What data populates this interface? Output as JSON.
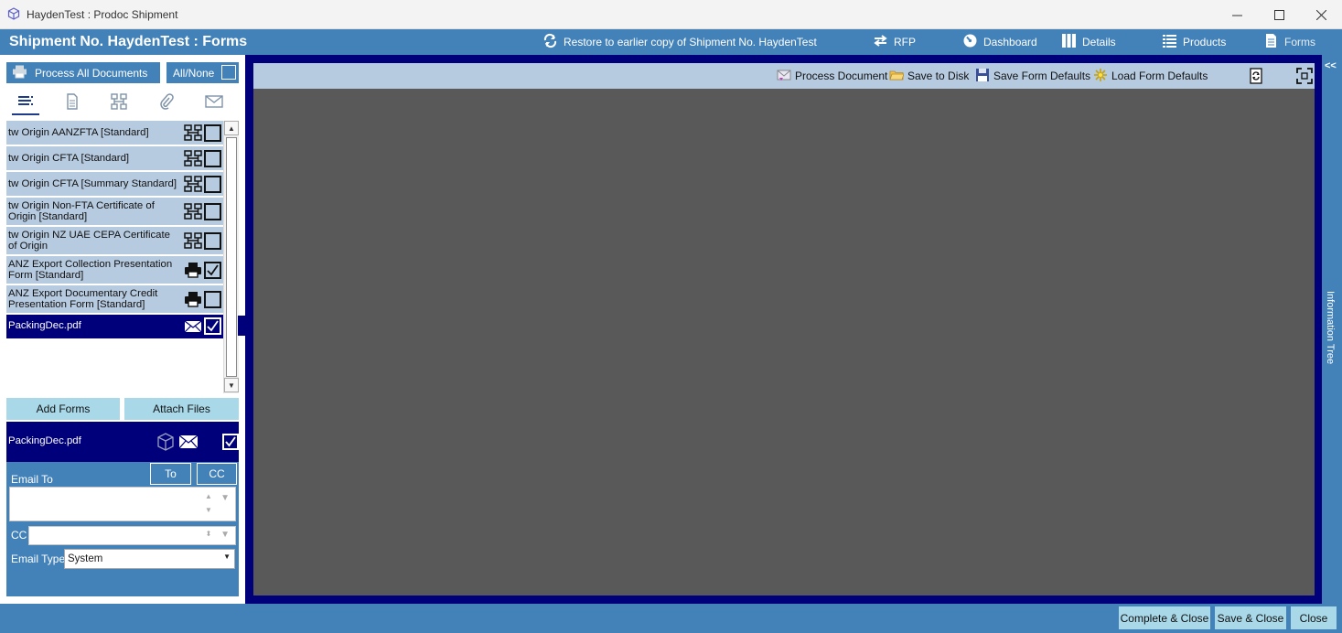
{
  "window": {
    "title": "HaydenTest : Prodoc Shipment",
    "app_icon": "cube-icon"
  },
  "header": {
    "title": "Shipment No. HaydenTest : Forms",
    "restore_label": "Restore to earlier copy of Shipment No. HaydenTest",
    "nav": [
      {
        "label": "RFP",
        "icon": "swap-arrows-icon"
      },
      {
        "label": "Dashboard",
        "icon": "gauge-icon"
      },
      {
        "label": "Details",
        "icon": "columns-icon"
      },
      {
        "label": "Products",
        "icon": "list-icon"
      },
      {
        "label": "Forms",
        "icon": "document-icon"
      }
    ]
  },
  "left": {
    "process_all_label": "Process All Documents",
    "all_none_label": "All/None",
    "tabs": [
      "list-icon",
      "document-icon",
      "flowchart-icon",
      "paperclip-icon",
      "envelope-icon"
    ],
    "items": [
      {
        "label": "tw Origin AANZFTA [Standard]",
        "icon": "flowchart-icon",
        "checked": false
      },
      {
        "label": "tw Origin CFTA [Standard]",
        "icon": "flowchart-icon",
        "checked": false
      },
      {
        "label": "tw Origin CFTA [Summary Standard]",
        "icon": "flowchart-icon",
        "checked": false
      },
      {
        "label": "tw Origin Non-FTA Certificate of Origin [Standard]",
        "icon": "flowchart-icon",
        "checked": false
      },
      {
        "label": "tw Origin NZ UAE CEPA Certificate of Origin",
        "icon": "flowchart-icon",
        "checked": false
      },
      {
        "label": "ANZ Export Collection Presentation Form [Standard]",
        "icon": "printer-icon",
        "checked": true
      },
      {
        "label": "ANZ Export Documentary Credit Presentation Form [Standard]",
        "icon": "printer-icon",
        "checked": false
      },
      {
        "label": "PackingDec.pdf",
        "icon": "envelope-icon",
        "checked": true,
        "selected": true
      }
    ],
    "add_forms_label": "Add Forms",
    "attach_files_label": "Attach Files",
    "selected_doc": {
      "label": "PackingDec.pdf",
      "checked": true
    },
    "email": {
      "email_to_label": "Email To",
      "to_button": "To",
      "cc_button": "CC",
      "cc_label": "CC",
      "email_type_label": "Email Type",
      "email_type_value": "System",
      "email_to_value": "",
      "cc_value": ""
    }
  },
  "viewer": {
    "toolbar": {
      "process_document": "Process Document",
      "save_to_disk": "Save to Disk",
      "save_form_defaults": "Save Form Defaults",
      "load_form_defaults": "Load Form Defaults"
    },
    "side_panel_label": "Information Tree",
    "side_collapse": "<<"
  },
  "footer": {
    "complete_close": "Complete & Close",
    "save_close": "Save & Close",
    "close": "Close"
  },
  "colors": {
    "header_blue": "#4382b9",
    "navy": "#00007a",
    "item_bg": "#b6cae0",
    "button_light": "#a9d8e8",
    "canvas": "#595959"
  }
}
